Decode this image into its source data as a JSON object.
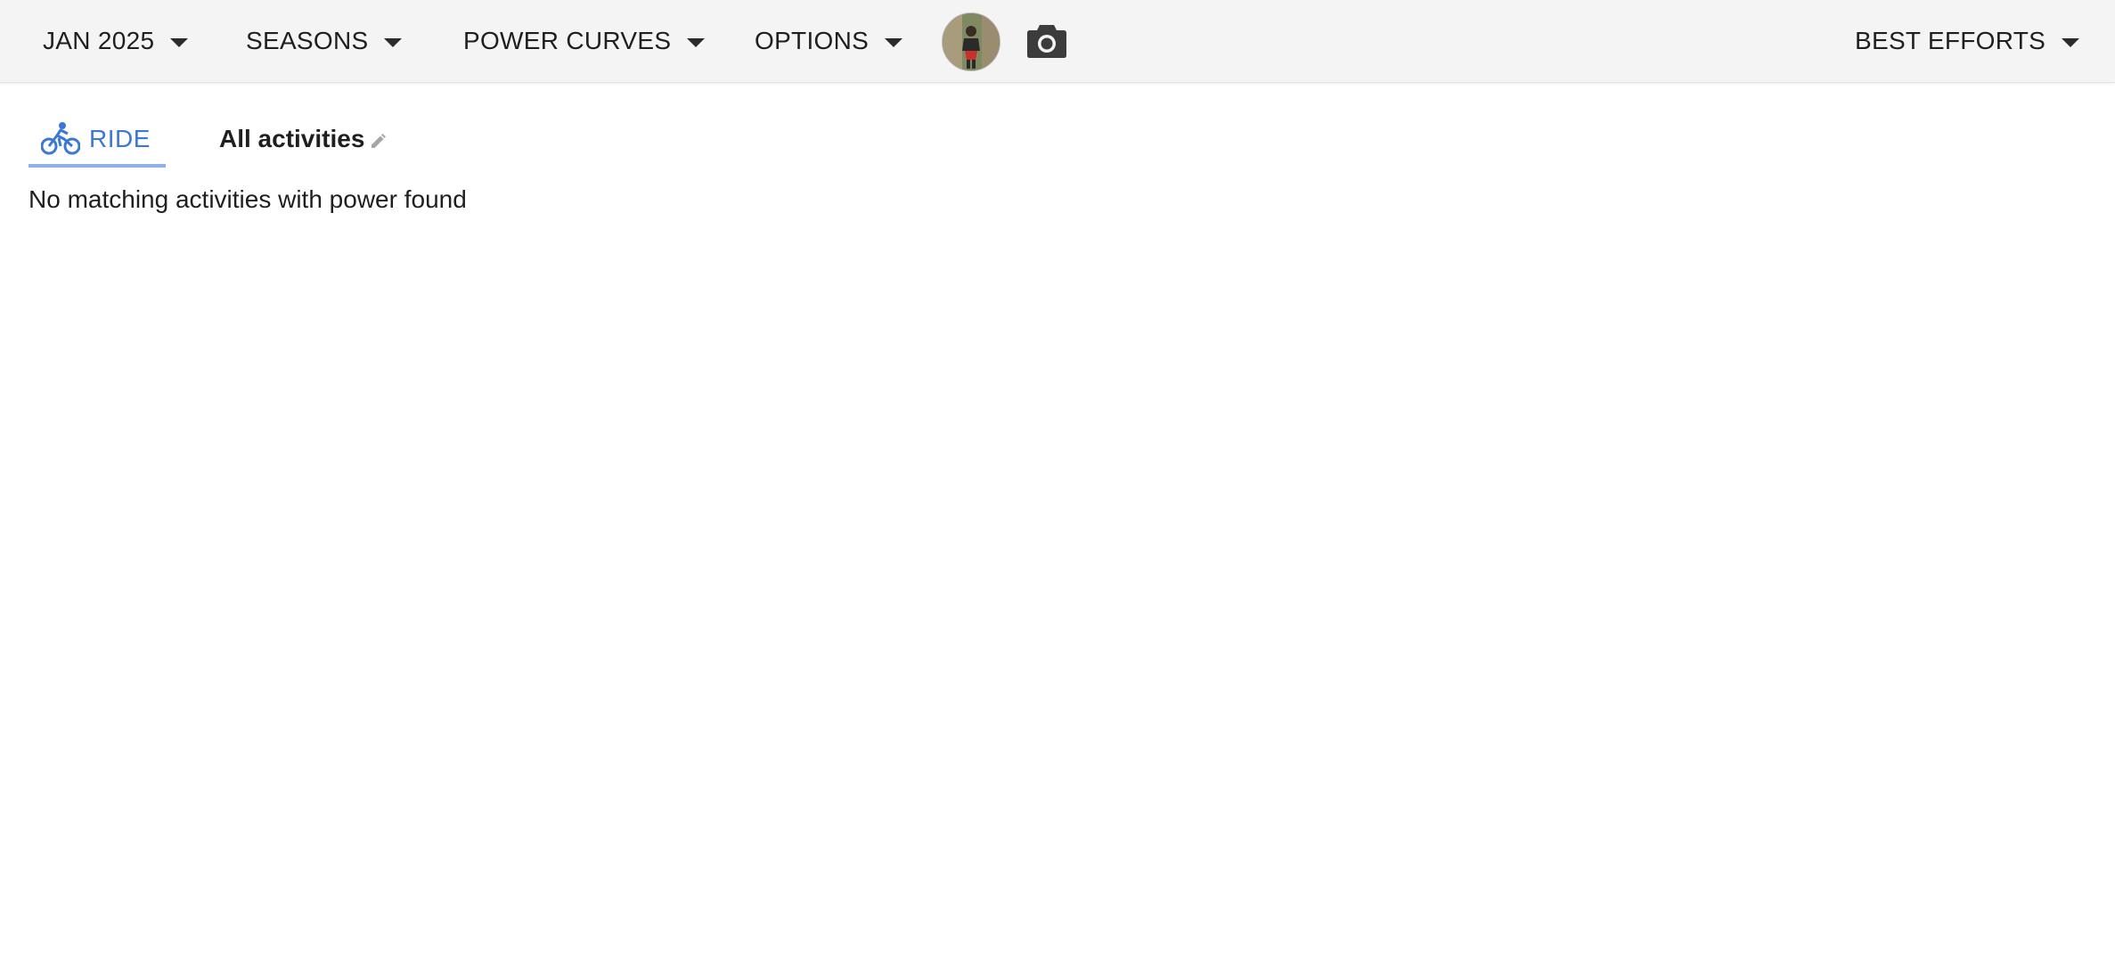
{
  "toolbar": {
    "month": {
      "label": "JAN 2025",
      "icon": "caret-down-icon"
    },
    "seasons": {
      "label": "SEASONS",
      "icon": "caret-down-icon"
    },
    "power_curves": {
      "label": "POWER CURVES",
      "icon": "caret-down-icon"
    },
    "options": {
      "label": "OPTIONS",
      "icon": "caret-down-icon"
    },
    "avatar": {
      "icon": "user-avatar"
    },
    "screenshot": {
      "icon": "camera-icon"
    },
    "best_efforts": {
      "label": "BEST EFFORTS",
      "icon": "caret-down-icon"
    }
  },
  "tabs": {
    "ride": {
      "label": "RIDE",
      "icon": "bicycle-icon",
      "active": true,
      "color": "#3b78d4"
    },
    "all_activities": {
      "label": "All activities",
      "icon": "pencil-icon"
    }
  },
  "main": {
    "empty_message": "No matching activities with power found"
  },
  "colors": {
    "accent": "#3b78d4",
    "tab_underline": "#8fb0ea",
    "toolbar_bg": "#f4f4f4"
  }
}
